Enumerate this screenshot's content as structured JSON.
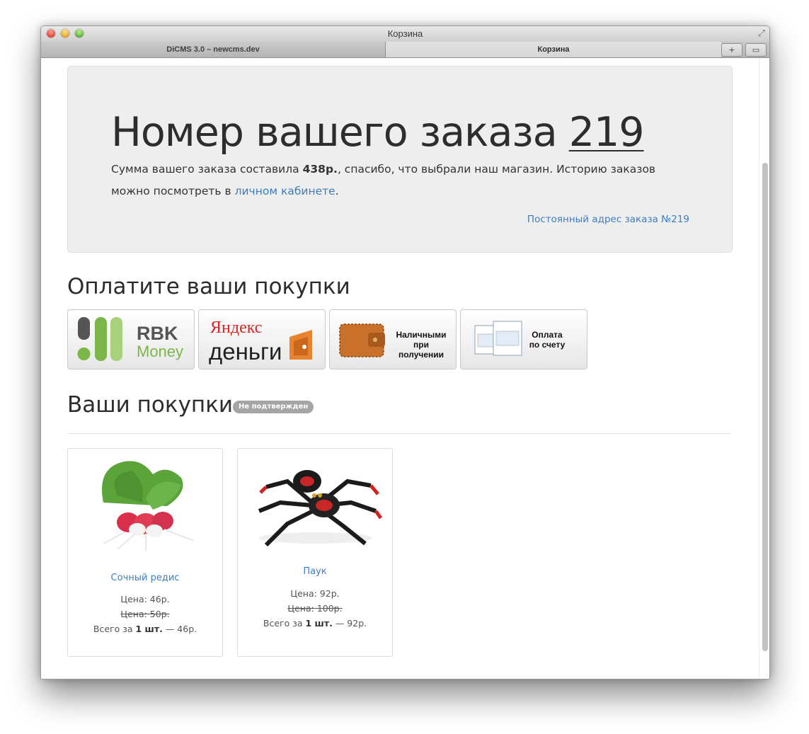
{
  "window": {
    "title": "Корзина",
    "tabs": [
      {
        "label": "DiCMS 3.0 – newcms.dev",
        "active": false
      },
      {
        "label": "Корзина",
        "active": true
      }
    ]
  },
  "hero": {
    "title_prefix": "Номер вашего заказа",
    "order_number": "219",
    "sum_prefix": "Сумма вашего заказа составила",
    "sum_value": "438р.",
    "sum_suffix": ", спасибо, что выбрали наш магазин. Историю заказов можно посмотреть в",
    "cabinet_link": "личном кабинете",
    "period": ".",
    "permalink": "Постоянный адрес заказа №219"
  },
  "payment": {
    "heading": "Оплатите ваши покупки",
    "methods": [
      {
        "id": "rbk",
        "line1": "RBK",
        "line2": "Money"
      },
      {
        "id": "yandex",
        "line1": "Яндекс",
        "line2": "деньги"
      },
      {
        "id": "cash",
        "line1": "Наличными",
        "line2": "при получении"
      },
      {
        "id": "invoice",
        "line1": "Оплата",
        "line2": "по счету"
      }
    ]
  },
  "cart": {
    "heading": "Ваши покупки",
    "status": "Не подтвержден",
    "items": [
      {
        "name": "Сочный редис",
        "price": "Цена: 46р.",
        "old_price": "Цена: 50р.",
        "total_prefix": "Всего за",
        "qty": "1 шт.",
        "total_suffix": "— 46р."
      },
      {
        "name": "Паук",
        "price": "Цена: 92р.",
        "old_price": "Цена: 100р.",
        "total_prefix": "Всего за",
        "qty": "1 шт.",
        "total_suffix": "— 92р."
      }
    ]
  },
  "colors": {
    "link": "#3d7cc1",
    "hero_bg": "#eeeeee",
    "badge": "#a5a5a5",
    "rbk_green": "#7ab648",
    "yandex_orange": "#e8822e"
  }
}
